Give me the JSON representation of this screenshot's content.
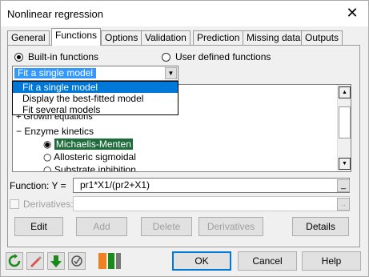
{
  "window": {
    "title": "Nonlinear regression",
    "close_glyph": "✕"
  },
  "tabs": [
    "General",
    "Functions",
    "Options",
    "Validation",
    "Prediction",
    "Missing data",
    "Outputs"
  ],
  "active_tab": "Functions",
  "functions": {
    "radio_builtin": "Built-in functions",
    "radio_user": "User defined functions",
    "combo_value": "Fit a single model",
    "combo_options": [
      "Fit a single model",
      "Display the best-fitted model",
      "Fit several models"
    ],
    "tree": {
      "growth": "Growth equations",
      "enzyme": "Enzyme kinetics",
      "items": [
        "Michaelis-Menten",
        "Allosteric sigmoidal",
        "Substrate inhibition"
      ],
      "selected": "Michaelis-Menten"
    },
    "function_label": "Function: Y =",
    "function_value": "pr1*X1/(pr2+X1)",
    "derivatives_label": "Derivatives:",
    "buttons": {
      "edit": "Edit",
      "add": "Add",
      "delete": "Delete",
      "derivatives": "Derivatives",
      "details": "Details"
    }
  },
  "footer": {
    "ok": "OK",
    "cancel": "Cancel",
    "help": "Help"
  },
  "colors": {
    "accent": "#0078d7",
    "tree_highlight": "#1e6b3b"
  }
}
